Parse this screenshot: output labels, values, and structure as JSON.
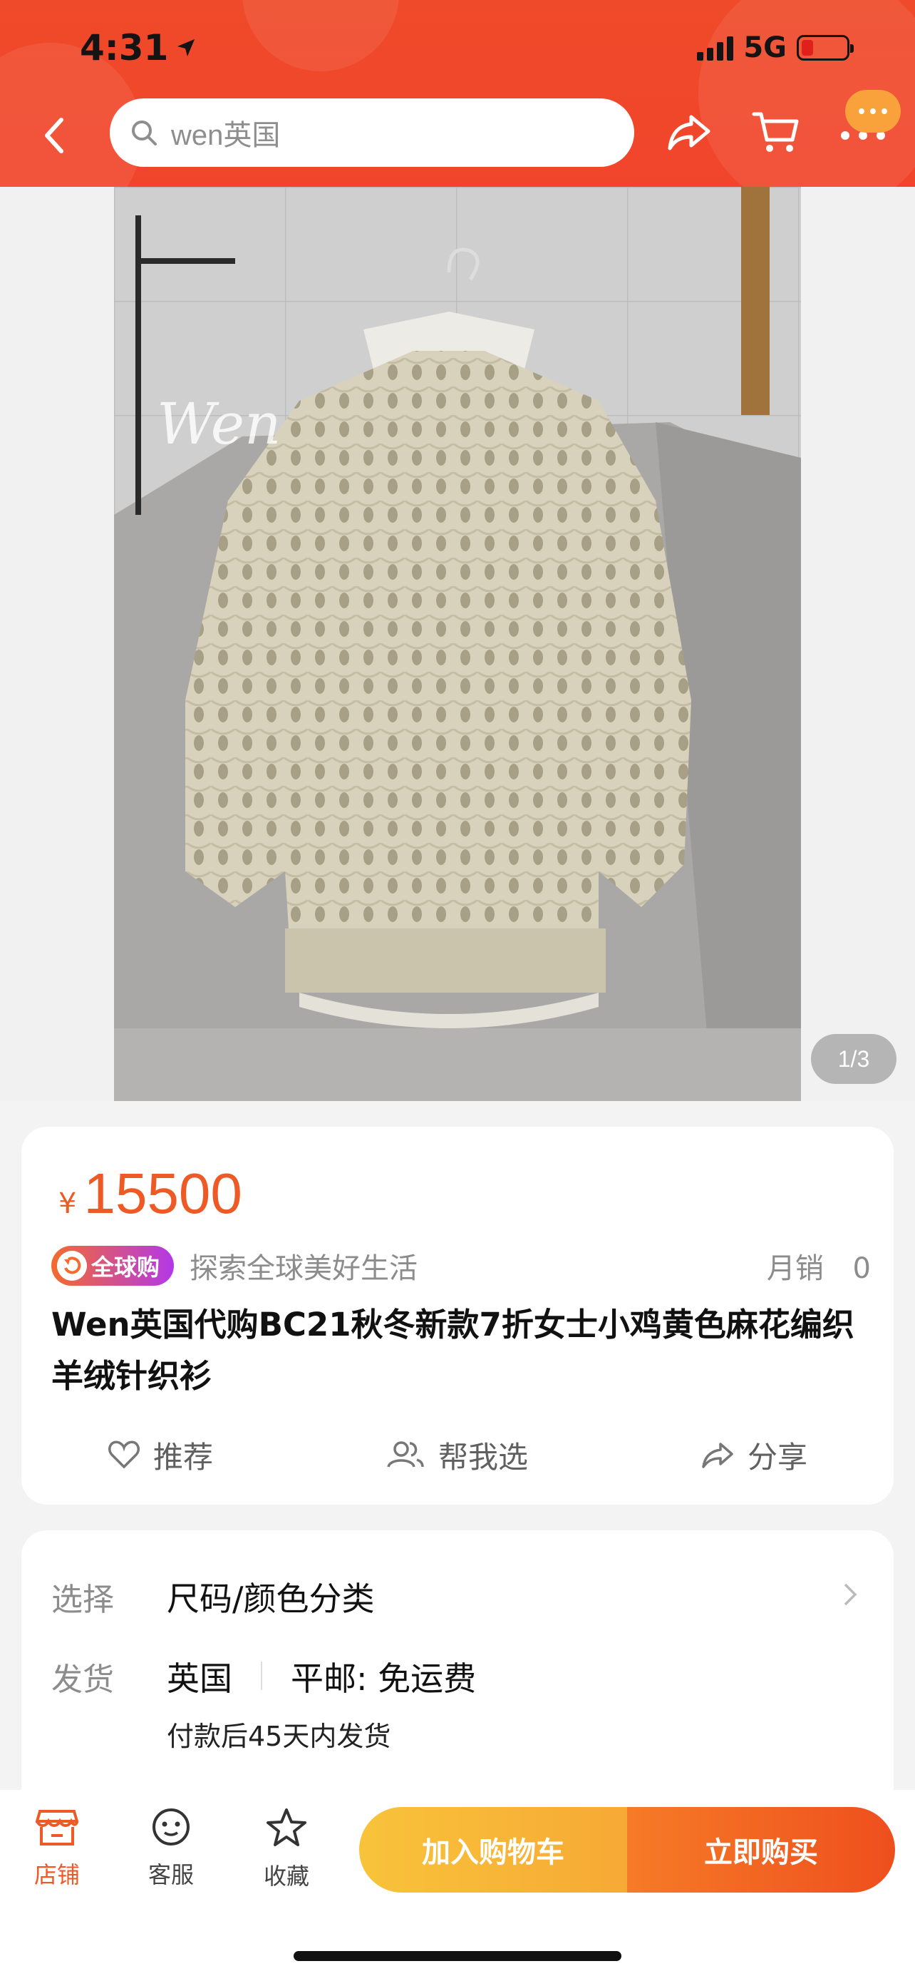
{
  "status_bar": {
    "time": "4:31",
    "network": "5G"
  },
  "header": {
    "search_text": "wen英国",
    "icons": [
      "back-icon",
      "search-icon",
      "share-icon",
      "cart-icon",
      "more-icon"
    ]
  },
  "product_image": {
    "counter": "1/3",
    "description_icon": "sweater-photo"
  },
  "price_card": {
    "currency": "¥",
    "price": "15500",
    "global_tag": "全球购",
    "tagline": "探索全球美好生活",
    "sales_label": "月销",
    "sales_value": "0",
    "title": "Wen英国代购BC21秋冬新款7折女士小鸡黄色麻花编织羊绒针织衫",
    "actions": [
      {
        "label": "推荐",
        "icon": "heart-icon"
      },
      {
        "label": "帮我选",
        "icon": "people-icon"
      },
      {
        "label": "分享",
        "icon": "share-icon"
      }
    ]
  },
  "spec_card": {
    "select_label": "选择",
    "select_value": "尺码/颜色分类",
    "ship_label": "发货",
    "ship_origin": "英国",
    "ship_method": "平邮: 免运费",
    "ship_note": "付款后45天内发货"
  },
  "bottom_bar": {
    "tabs": [
      {
        "label": "店铺",
        "icon": "shop-icon"
      },
      {
        "label": "客服",
        "icon": "service-icon"
      },
      {
        "label": "收藏",
        "icon": "star-icon"
      }
    ],
    "add_to_cart": "加入购物车",
    "buy_now": "立即购买"
  },
  "colors": {
    "accent": "#ee5a26",
    "header_bg": "#ef4a2a",
    "cta_yellow": "#f8c33a",
    "cta_orange": "#ee4f1d"
  }
}
